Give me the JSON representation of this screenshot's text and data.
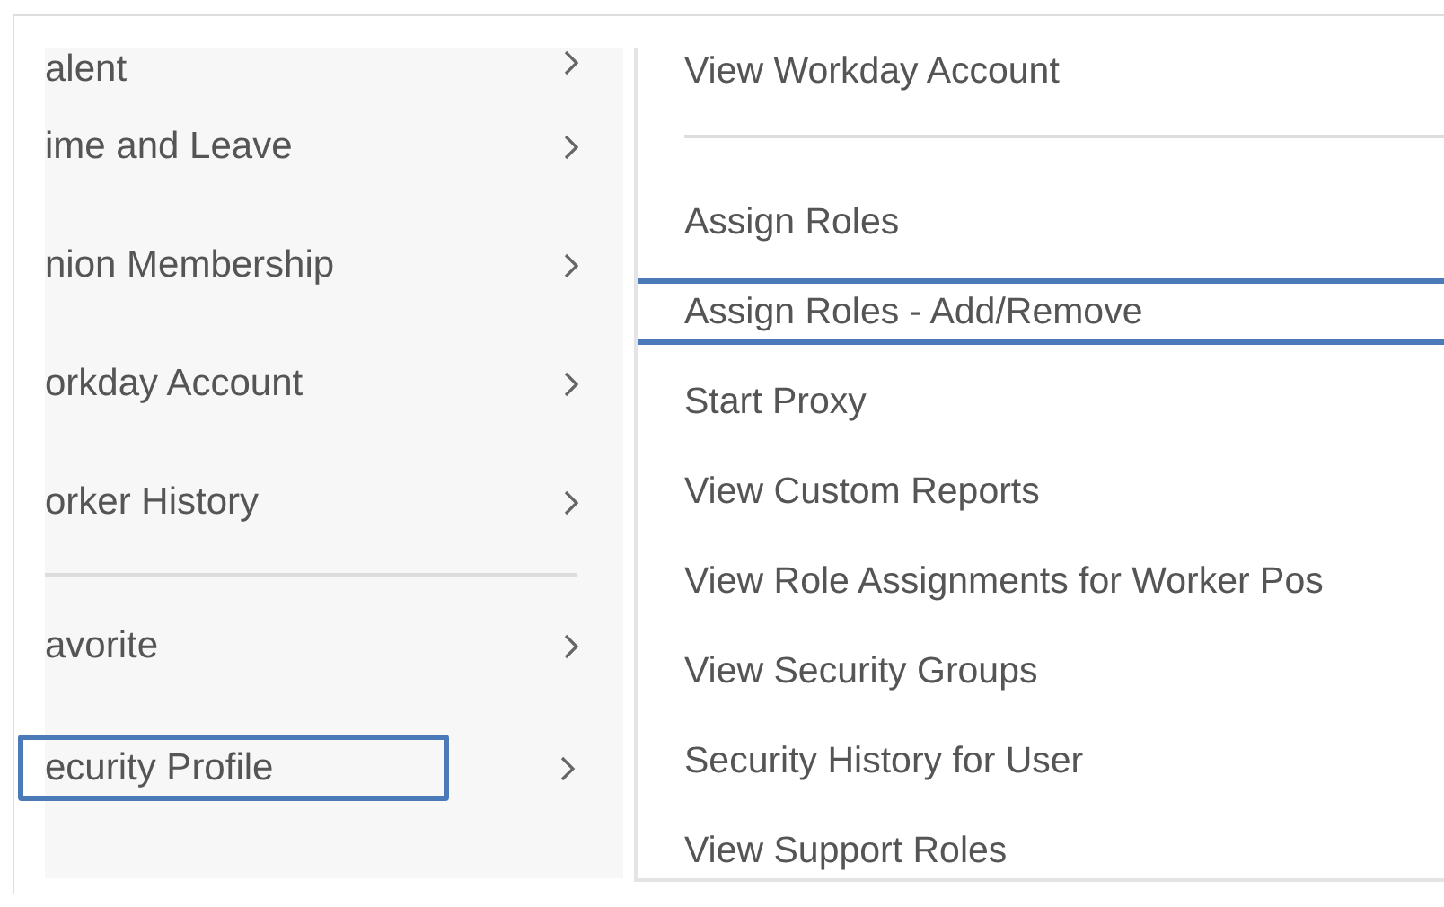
{
  "menu": {
    "items": [
      {
        "label": "alent",
        "selected": false
      },
      {
        "label": "ime and Leave",
        "selected": false
      },
      {
        "label": "nion Membership",
        "selected": false
      },
      {
        "label": "orkday Account",
        "selected": false
      },
      {
        "label": "orker History",
        "selected": false
      },
      {
        "kind": "divider"
      },
      {
        "label": "avorite",
        "selected": false
      },
      {
        "label": "ecurity Profile",
        "selected": true
      }
    ]
  },
  "submenu": {
    "items": [
      {
        "label": "View Workday Account",
        "selected": false
      },
      {
        "kind": "divider"
      },
      {
        "label": "Assign Roles",
        "selected": false
      },
      {
        "label": "Assign Roles - Add/Remove",
        "selected": true
      },
      {
        "label": "Start Proxy",
        "selected": false
      },
      {
        "label": "View Custom Reports",
        "selected": false
      },
      {
        "label": "View Role Assignments for Worker Pos",
        "selected": false
      },
      {
        "label": "View Security Groups",
        "selected": false
      },
      {
        "label": "Security History for User",
        "selected": false
      },
      {
        "label": "View Support Roles",
        "selected": false
      }
    ]
  }
}
